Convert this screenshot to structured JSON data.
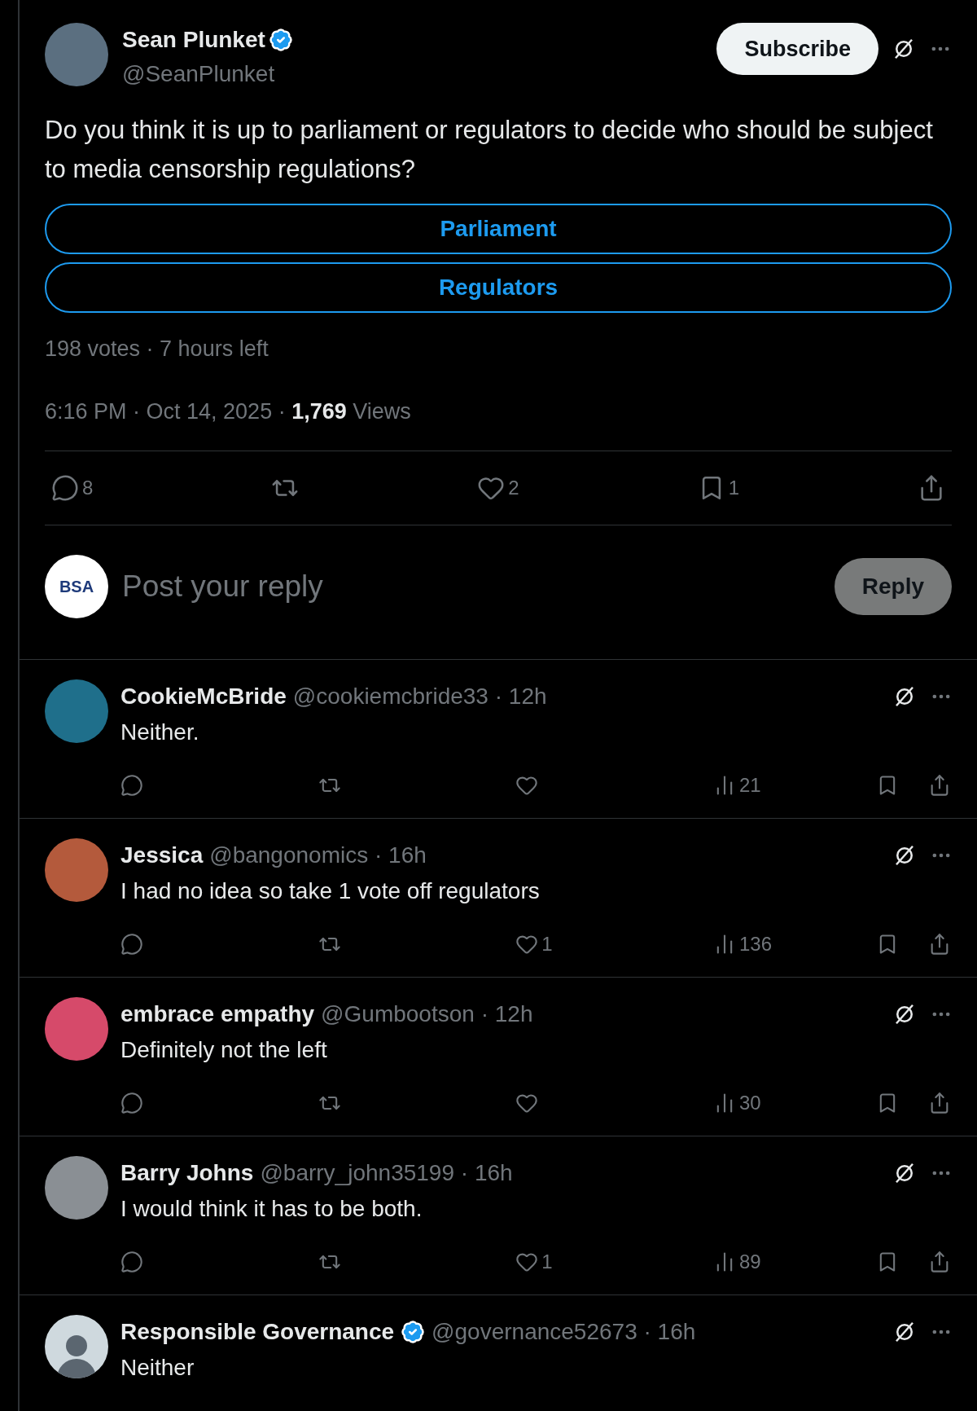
{
  "post": {
    "author": {
      "name": "Sean Plunket",
      "handle": "@SeanPlunket",
      "verified": true
    },
    "subscribe_button": "Subscribe",
    "text": "Do you think it is up to parliament or regulators to decide who should be subject to media censorship regulations?",
    "poll": {
      "options": [
        "Parliament",
        "Regulators"
      ],
      "summary": "198 votes · 7 hours left"
    },
    "meta": "6:16 PM · Oct 14, 2025 · **1,769** Views",
    "actions": [
      {
        "kind": "reply",
        "count": "8"
      },
      {
        "kind": "repost"
      },
      {
        "kind": "like",
        "count": "2"
      },
      {
        "kind": "bookmark",
        "count": "1"
      },
      {
        "kind": "share"
      }
    ]
  },
  "reply_box": {
    "avatar_text": "BSA",
    "placeholder": "Post your reply",
    "button": "Reply",
    "disabled": true
  },
  "replies": [
    {
      "name": "CookieMcBride",
      "verified": false,
      "meta": "@cookiemcbride33 · 12h",
      "text": "Neither.",
      "actions": [
        {
          "kind": "reply"
        },
        {
          "kind": "repost"
        },
        {
          "kind": "like"
        },
        {
          "kind": "views",
          "count": "21"
        },
        {
          "kind": "bookmark"
        },
        {
          "kind": "share"
        }
      ]
    },
    {
      "name": "Jessica",
      "verified": false,
      "meta": "@bangonomics · 16h",
      "text": "I had no idea so take 1 vote off regulators",
      "actions": [
        {
          "kind": "reply"
        },
        {
          "kind": "repost"
        },
        {
          "kind": "like",
          "count": "1"
        },
        {
          "kind": "views",
          "count": "136"
        },
        {
          "kind": "bookmark"
        },
        {
          "kind": "share"
        }
      ]
    },
    {
      "name": "embrace empathy",
      "verified": false,
      "meta": "@Gumbootson · 12h",
      "text": "Definitely not the left",
      "actions": [
        {
          "kind": "reply"
        },
        {
          "kind": "repost"
        },
        {
          "kind": "like"
        },
        {
          "kind": "views",
          "count": "30"
        },
        {
          "kind": "bookmark"
        },
        {
          "kind": "share"
        }
      ]
    },
    {
      "name": "Barry Johns",
      "verified": false,
      "meta": "@barry_john35199 · 16h",
      "text": "I would think it has to be both.",
      "actions": [
        {
          "kind": "reply"
        },
        {
          "kind": "repost"
        },
        {
          "kind": "like",
          "count": "1"
        },
        {
          "kind": "views",
          "count": "89"
        },
        {
          "kind": "bookmark"
        },
        {
          "kind": "share"
        }
      ]
    },
    {
      "name": "Responsible Governance",
      "verified": true,
      "meta": "@governance52673 · 16h",
      "text": "Neither"
    }
  ]
}
